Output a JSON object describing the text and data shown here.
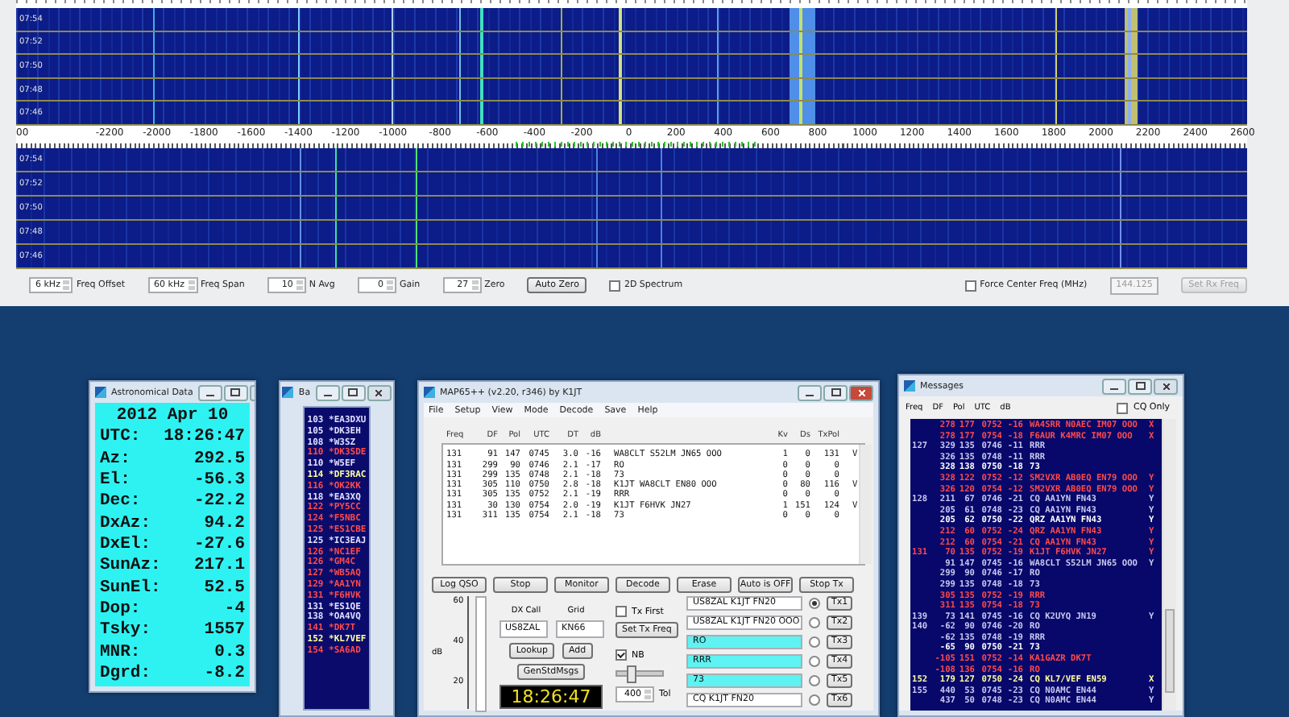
{
  "spectrum_window": {
    "top_waterfall": {
      "time_labels": [
        "07:54",
        "07:52",
        "07:50",
        "07:48",
        "07:46"
      ]
    },
    "frequency_axis": {
      "labels": [
        "00",
        "-2200",
        "-2000",
        "-1800",
        "-1600",
        "-1400",
        "-1200",
        "-1000",
        "-800",
        "-600",
        "-400",
        "-200",
        "0",
        "200",
        "400",
        "600",
        "800",
        "1000",
        "1200",
        "1400",
        "1600",
        "1800",
        "2000",
        "2200",
        "2400",
        "2600"
      ]
    },
    "bottom_waterfall": {
      "time_labels": [
        "07:54",
        "07:52",
        "07:50",
        "07:48",
        "07:46"
      ]
    },
    "controls_left": [
      {
        "kind": "spinner",
        "value": "6 kHz",
        "label": "Freq Offset"
      },
      {
        "kind": "spinner",
        "value": "60 kHz",
        "label": "Freq Span"
      },
      {
        "kind": "spinner",
        "value": "10",
        "label": "N Avg"
      },
      {
        "kind": "spinner",
        "value": "0",
        "label": "Gain"
      },
      {
        "kind": "spinner",
        "value": "27",
        "label": "Zero"
      },
      {
        "kind": "button",
        "label": "Auto Zero",
        "disabled": false
      },
      {
        "kind": "checkbox",
        "label": "2D Spectrum",
        "checked": false
      }
    ],
    "controls_right": [
      {
        "kind": "checkbox",
        "label": "Force Center Freq (MHz)",
        "checked": false
      },
      {
        "kind": "field",
        "value": "144.125",
        "disabled": true
      },
      {
        "kind": "button",
        "label": "Set Rx Freq",
        "disabled": true
      }
    ]
  },
  "astro_window": {
    "title": "Astronomical Data",
    "date": "2012 Apr 10",
    "rows": [
      {
        "label": "UTC:",
        "value": "18:26:47"
      },
      {
        "label": "Az:",
        "value": "292.5"
      },
      {
        "label": "El:",
        "value": "-56.3"
      },
      {
        "label": "Dec:",
        "value": "-22.2"
      },
      {
        "label": "DxAz:",
        "value": "94.2"
      },
      {
        "label": "DxEl:",
        "value": "-27.6"
      },
      {
        "label": "SunAz:",
        "value": "217.1"
      },
      {
        "label": "SunEl:",
        "value": "52.5"
      },
      {
        "label": "Dop:",
        "value": "-4"
      },
      {
        "label": "Tsky:",
        "value": "1557"
      },
      {
        "label": "MNR:",
        "value": "0.3"
      },
      {
        "label": "Dgrd:",
        "value": "-8.2"
      }
    ]
  },
  "band_map_window": {
    "title": "Ba",
    "entries": [
      {
        "text": "103 *EA3DXU",
        "color": "#e0e0ff"
      },
      {
        "text": "105 *DK3EH",
        "color": "#e0e0ff"
      },
      {
        "text": "108 *W3SZ",
        "color": "#e0e0ff"
      },
      {
        "text": "110 *DK3SDE",
        "color": "#ff4a4a"
      },
      {
        "text": "110 *W5EF",
        "color": "#e0e0ff"
      },
      {
        "text": "114 *DF3RAC",
        "color": "#ffffa0"
      },
      {
        "text": "116 *OK2KK",
        "color": "#ff4a4a"
      },
      {
        "text": "118 *EA3XQ",
        "color": "#e0e0ff"
      },
      {
        "text": "122 *PY5CC",
        "color": "#ff4a4a"
      },
      {
        "text": "124 *F5NBC",
        "color": "#ff4a4a"
      },
      {
        "text": "125 *ES1CBE",
        "color": "#ff4a4a"
      },
      {
        "text": "125 *IC3EAJ",
        "color": "#e0e0ff"
      },
      {
        "text": "126 *NC1EF",
        "color": "#ff4a4a"
      },
      {
        "text": "126 *GM4C",
        "color": "#ff4a4a"
      },
      {
        "text": "127 *WB5AQ",
        "color": "#ff4a4a"
      },
      {
        "text": "129 *AA1YN",
        "color": "#ff4a4a"
      },
      {
        "text": "131 *F6HVK",
        "color": "#ff4a4a"
      },
      {
        "text": "131 *ES1QE",
        "color": "#e0e0ff"
      },
      {
        "text": "138 *OA4VQ",
        "color": "#e0e0ff"
      },
      {
        "text": "141 *DK7T",
        "color": "#ff4a4a"
      },
      {
        "text": "152 *KL7VEF",
        "color": "#ffffa0"
      },
      {
        "text": "154 *SA6AD",
        "color": "#ff4a4a"
      }
    ]
  },
  "map65_window": {
    "title": "MAP65++   (v2.20, r346)   by K1JT",
    "menu": [
      "File",
      "Setup",
      "View",
      "Mode",
      "Decode",
      "Save",
      "Help"
    ],
    "columns": [
      "Freq",
      "DF",
      "Pol",
      "UTC",
      "DT",
      "dB",
      "",
      "Kv",
      "Ds",
      "TxPol"
    ],
    "rows": [
      [
        "131",
        "91",
        "147",
        "0745",
        "3.0",
        "-16",
        "WA8CLT S52LM JN65 OOO",
        "1",
        "0",
        "131",
        "V"
      ],
      [
        "131",
        "299",
        "90",
        "0746",
        "2.1",
        "-17",
        "RO",
        "0",
        "0",
        "0"
      ],
      [
        "131",
        "299",
        "135",
        "0748",
        "2.1",
        "-18",
        "73",
        "0",
        "0",
        "0"
      ],
      [
        "131",
        "305",
        "110",
        "0750",
        "2.8",
        "-18",
        "K1JT WA8CLT EN80 OOO",
        "0",
        "80",
        "116",
        "V"
      ],
      [
        "131",
        "305",
        "135",
        "0752",
        "2.1",
        "-19",
        "RRR",
        "0",
        "0",
        "0"
      ],
      [
        "131",
        "30",
        "130",
        "0754",
        "2.0",
        "-19",
        "K1JT F6HVK JN27",
        "1",
        "151",
        "124",
        "V"
      ],
      [
        "131",
        "311",
        "135",
        "0754",
        "2.1",
        "-18",
        "73",
        "0",
        "0",
        "0"
      ]
    ],
    "buttons": [
      "Log QSO",
      "Stop",
      "Monitor",
      "Decode",
      "Erase",
      "Auto is OFF",
      "Stop Tx"
    ],
    "meter": {
      "ticks": [
        "60",
        "40",
        "20"
      ],
      "unit": "dB"
    },
    "dx": {
      "call_label": "DX Call",
      "grid_label": "Grid",
      "call": "US8ZAL",
      "grid": "KN66",
      "lookup": "Lookup",
      "add": "Add",
      "gen": "GenStdMsgs"
    },
    "clock": "18:26:47",
    "tx_first": {
      "label": "Tx First",
      "checked": false
    },
    "set_tx_freq": "Set Tx Freq",
    "nb": {
      "label": "NB",
      "checked": true,
      "level": 0.3
    },
    "tol": {
      "value": "400",
      "label": "Tol"
    },
    "tx_messages": [
      {
        "text": "US8ZAL K1JT FN20",
        "highlighted": false,
        "selected": true,
        "button": "Tx1"
      },
      {
        "text": "US8ZAL K1JT FN20 OOO",
        "highlighted": false,
        "selected": false,
        "button": "Tx2"
      },
      {
        "text": "RO",
        "highlighted": true,
        "selected": false,
        "button": "Tx3"
      },
      {
        "text": "RRR",
        "highlighted": true,
        "selected": false,
        "button": "Tx4"
      },
      {
        "text": "73",
        "highlighted": true,
        "selected": false,
        "button": "Tx5"
      },
      {
        "text": "CQ K1JT FN20",
        "highlighted": false,
        "selected": false,
        "button": "Tx6"
      }
    ]
  },
  "messages_window": {
    "title": "Messages",
    "columns": [
      "Freq",
      "DF",
      "Pol",
      "UTC",
      "dB"
    ],
    "cq_only": {
      "label": "CQ Only",
      "checked": false
    },
    "rows": [
      {
        "df": "278",
        "pol": "177",
        "utc": "0752",
        "db": "-16",
        "message": "WA4SRR N0AEC IM07 OOO",
        "flag": "X",
        "color": "#ff4a4a"
      },
      {
        "df": "278",
        "pol": "177",
        "utc": "0754",
        "db": "-18",
        "message": "F6AUR K4MRC IM07 OOO",
        "flag": "X",
        "color": "#ff4a4a"
      },
      {
        "freq": "127",
        "df": "329",
        "pol": "135",
        "utc": "0746",
        "db": "-11",
        "message": "RRR",
        "color": "#c8c8f0"
      },
      {
        "df": "326",
        "pol": "135",
        "utc": "0748",
        "db": "-11",
        "message": "RRR",
        "color": "#c8c8f0"
      },
      {
        "df": "328",
        "pol": "138",
        "utc": "0750",
        "db": "-18",
        "message": "73",
        "color": "#ffffff"
      },
      {
        "df": "328",
        "pol": "122",
        "utc": "0752",
        "db": "-12",
        "message": "SM2VXR AB0EQ EN79 OOO",
        "flag": "Y",
        "color": "#ff4a4a"
      },
      {
        "df": "326",
        "pol": "120",
        "utc": "0754",
        "db": "-12",
        "message": "SM2VXR AB0EQ EN79 OOO",
        "flag": "Y",
        "color": "#ff4a4a"
      },
      {
        "freq": "128",
        "df": "211",
        "pol": "67",
        "utc": "0746",
        "db": "-21",
        "message": "CQ AA1YN FN43",
        "flag": "Y",
        "color": "#c8c8f0"
      },
      {
        "df": "205",
        "pol": "61",
        "utc": "0748",
        "db": "-23",
        "message": "CQ AA1YN FN43",
        "flag": "Y",
        "color": "#c8c8f0"
      },
      {
        "df": "205",
        "pol": "62",
        "utc": "0750",
        "db": "-22",
        "message": "QRZ AA1YN FN43",
        "flag": "Y",
        "color": "#ffffff"
      },
      {
        "df": "212",
        "pol": "60",
        "utc": "0752",
        "db": "-24",
        "message": "QRZ AA1YN FN43",
        "flag": "Y",
        "color": "#ff4a4a"
      },
      {
        "df": "212",
        "pol": "60",
        "utc": "0754",
        "db": "-21",
        "message": "CQ AA1YN FN43",
        "flag": "Y",
        "color": "#ff4a4a"
      },
      {
        "freq": "131",
        "df": "70",
        "pol": "135",
        "utc": "0752",
        "db": "-19",
        "message": "K1JT F6HVK JN27",
        "flag": "Y",
        "color": "#ff4a4a"
      },
      {
        "df": "91",
        "pol": "147",
        "utc": "0745",
        "db": "-16",
        "message": "WA8CLT S52LM JN65 OOO",
        "flag": "Y",
        "color": "#c8c8f0"
      },
      {
        "df": "299",
        "pol": "90",
        "utc": "0746",
        "db": "-17",
        "message": "RO",
        "color": "#c8c8f0"
      },
      {
        "df": "299",
        "pol": "135",
        "utc": "0748",
        "db": "-18",
        "message": "73",
        "color": "#c8c8f0"
      },
      {
        "df": "305",
        "pol": "135",
        "utc": "0752",
        "db": "-19",
        "message": "RRR",
        "color": "#ff4a4a"
      },
      {
        "df": "311",
        "pol": "135",
        "utc": "0754",
        "db": "-18",
        "message": "73",
        "color": "#ff4a4a"
      },
      {
        "freq": "139",
        "df": "73",
        "pol": "141",
        "utc": "0745",
        "db": "-16",
        "message": "CQ K2UYQ JN19",
        "flag": "Y",
        "color": "#c8c8f0"
      },
      {
        "freq": "140",
        "df": "-62",
        "pol": "90",
        "utc": "0746",
        "db": "-20",
        "message": "RO",
        "color": "#c8c8f0"
      },
      {
        "df": "-62",
        "pol": "135",
        "utc": "0748",
        "db": "-19",
        "message": "RRR",
        "color": "#c8c8f0"
      },
      {
        "df": "-65",
        "pol": "90",
        "utc": "0750",
        "db": "-21",
        "message": "73",
        "color": "#ffffff"
      },
      {
        "df": "-105",
        "pol": "151",
        "utc": "0752",
        "db": "-14",
        "message": "KA1GAZR DK7T",
        "color": "#ff4a4a"
      },
      {
        "df": "-108",
        "pol": "136",
        "utc": "0754",
        "db": "-16",
        "message": "RO",
        "color": "#ff4a4a"
      },
      {
        "freq": "152",
        "df": "179",
        "pol": "127",
        "utc": "0750",
        "db": "-24",
        "message": "CQ KL7/VEF EN59",
        "flag": "X",
        "color": "#ffffa0"
      },
      {
        "freq": "155",
        "df": "440",
        "pol": "53",
        "utc": "0745",
        "db": "-23",
        "message": "CQ N0AMC EN44",
        "flag": "Y",
        "color": "#c8c8f0"
      },
      {
        "df": "437",
        "pol": "50",
        "utc": "0748",
        "db": "-23",
        "message": "CQ N0AMC EN44",
        "flag": "Y",
        "color": "#c8c8f0"
      }
    ]
  }
}
